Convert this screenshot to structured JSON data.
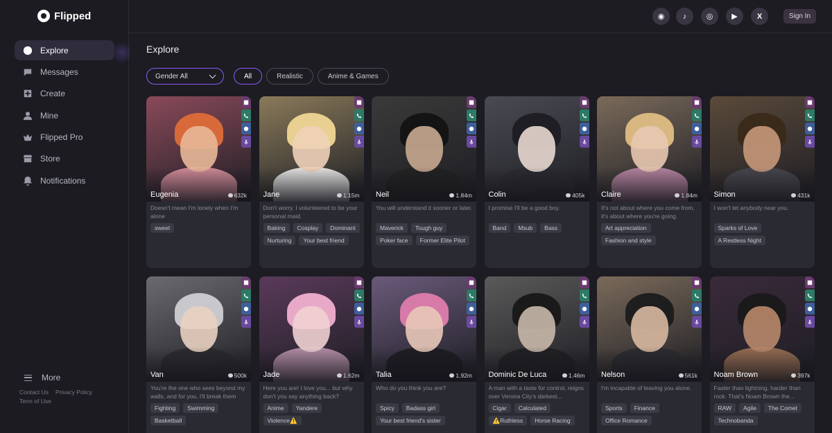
{
  "app": {
    "name": "Flipped"
  },
  "sidebar": {
    "items": [
      {
        "label": "Explore",
        "icon": "explore-icon",
        "active": true
      },
      {
        "label": "Messages",
        "icon": "chat-bubble-icon",
        "active": false
      },
      {
        "label": "Create",
        "icon": "plus-square-icon",
        "active": false
      },
      {
        "label": "Mine",
        "icon": "person-icon",
        "active": false
      },
      {
        "label": "Flipped Pro",
        "icon": "crown-icon",
        "active": false
      },
      {
        "label": "Store",
        "icon": "store-icon",
        "active": false
      },
      {
        "label": "Notifications",
        "icon": "bell-icon",
        "active": false
      }
    ],
    "more_label": "More",
    "footer": {
      "contact": "Contact Us",
      "privacy": "Privacy Policy",
      "terms": "Term of Use"
    }
  },
  "header": {
    "social": [
      {
        "icon": "discord-icon",
        "glyph": "◉"
      },
      {
        "icon": "tiktok-icon",
        "glyph": "♪"
      },
      {
        "icon": "instagram-icon",
        "glyph": "◎"
      },
      {
        "icon": "youtube-icon",
        "glyph": "▶"
      },
      {
        "icon": "x-icon",
        "glyph": "X"
      }
    ],
    "signin_label": "Sign In"
  },
  "main": {
    "title": "Explore",
    "gender_select": "Gender All",
    "filters": [
      {
        "label": "All",
        "active": true
      },
      {
        "label": "Realistic",
        "active": false
      },
      {
        "label": "Anime & Games",
        "active": false
      }
    ]
  },
  "characters": [
    {
      "name": "Eugenia",
      "count": "632k",
      "desc": "Doesn't mean I'm lonely when I'm alone",
      "tags": [
        "sweet"
      ],
      "colors": {
        "bg": "#8a4a5a",
        "hair": "#d86a3a",
        "skin": "#e8b898",
        "body": "#e89aa8"
      }
    },
    {
      "name": "Jane",
      "count": "1.15m",
      "desc": "Don't worry. I volunteered to be your personal maid.",
      "tags": [
        "Baking",
        "Cosplay",
        "Dominant",
        "Nurturing",
        "Your best friend"
      ],
      "colors": {
        "bg": "#8a7a5a",
        "hair": "#e8d090",
        "skin": "#f0d0b8",
        "body": "#ffffff"
      }
    },
    {
      "name": "Neil",
      "count": "1.84m",
      "desc": "You will understand it sooner or later.",
      "tags": [
        "Maverick",
        "Tough guy",
        "Poker face",
        "Former Elite Pilot"
      ],
      "colors": {
        "bg": "#3a3a3a",
        "hair": "#141414",
        "skin": "#c8a890",
        "body": "#222222"
      }
    },
    {
      "name": "Colin",
      "count": "405k",
      "desc": "I promise I'll be a good boy.",
      "tags": [
        "Band",
        "Msub",
        "Bass"
      ],
      "colors": {
        "bg": "#4a4a52",
        "hair": "#1e1e24",
        "skin": "#e8d8d0",
        "body": "#2a2a30"
      }
    },
    {
      "name": "Claire",
      "count": "1.84m",
      "desc": "It's not about where you come from, it's about where you're going.",
      "tags": [
        "Art appreciation",
        "Fashion and style"
      ],
      "colors": {
        "bg": "#7a6a5a",
        "hair": "#d8b880",
        "skin": "#e8c8b0",
        "body": "#c890b0"
      }
    },
    {
      "name": "Simon",
      "count": "431k",
      "desc": "I won't let anybody near you.",
      "tags": [
        "Sparks of Love",
        "A Restless Night"
      ],
      "colors": {
        "bg": "#5a4a3a",
        "hair": "#3a2a1a",
        "skin": "#c8987a",
        "body": "#4a4a52"
      }
    },
    {
      "name": "Van",
      "count": "500k",
      "desc": "You're the one who sees beyond my walls, and for you, I'll break them all...",
      "tags": [
        "Fighting",
        "Swimming",
        "Basketball"
      ],
      "colors": {
        "bg": "#6a6a70",
        "hair": "#c8c8cc",
        "skin": "#e8d0c0",
        "body": "#2a2a2e"
      }
    },
    {
      "name": "Jade",
      "count": "1.62m",
      "desc": "Here you are! I love you... but why don't you say anything back?",
      "tags": [
        "Anime",
        "Yandere",
        "Violence⚠️"
      ],
      "colors": {
        "bg": "#5a3a5a",
        "hair": "#e8a8c8",
        "skin": "#f0d0d0",
        "body": "#c8a0b8"
      }
    },
    {
      "name": "Talia",
      "count": "1.92m",
      "desc": "Who do you think you are?",
      "tags": [
        "Spicy",
        "Badass girl",
        "Your best friend's sister"
      ],
      "colors": {
        "bg": "#6a5a7a",
        "hair": "#d87aa8",
        "skin": "#e8c8b8",
        "body": "#1a1a1e"
      }
    },
    {
      "name": "Dominic De Luca",
      "count": "1.46m",
      "desc": "A man with a taste for control, reigns over Verona City's darkest...",
      "tags": [
        "Cigar",
        "Calculated",
        "⚠️Ruthless",
        "Horse Racing"
      ],
      "colors": {
        "bg": "#5a5a5a",
        "hair": "#1a1a1a",
        "skin": "#c8b8a8",
        "body": "#1e1e22"
      }
    },
    {
      "name": "Nelson",
      "count": "561k",
      "desc": "I'm incapable of leaving you alone.",
      "tags": [
        "Sports",
        "Finance",
        "Office Romance"
      ],
      "colors": {
        "bg": "#7a6a5a",
        "hair": "#1e1e1e",
        "skin": "#d8b8a0",
        "body": "#2a2a30"
      }
    },
    {
      "name": "Noam Brown",
      "count": "397k",
      "desc": "Faster than lightning, harder than rock. That's Noam Brown the...",
      "tags": [
        "RAW",
        "Agile",
        "The Comet",
        "Technobanda"
      ],
      "colors": {
        "bg": "#3a2a3a",
        "hair": "#1a1a1a",
        "skin": "#b8886a",
        "body": "#a87a5a"
      }
    }
  ]
}
